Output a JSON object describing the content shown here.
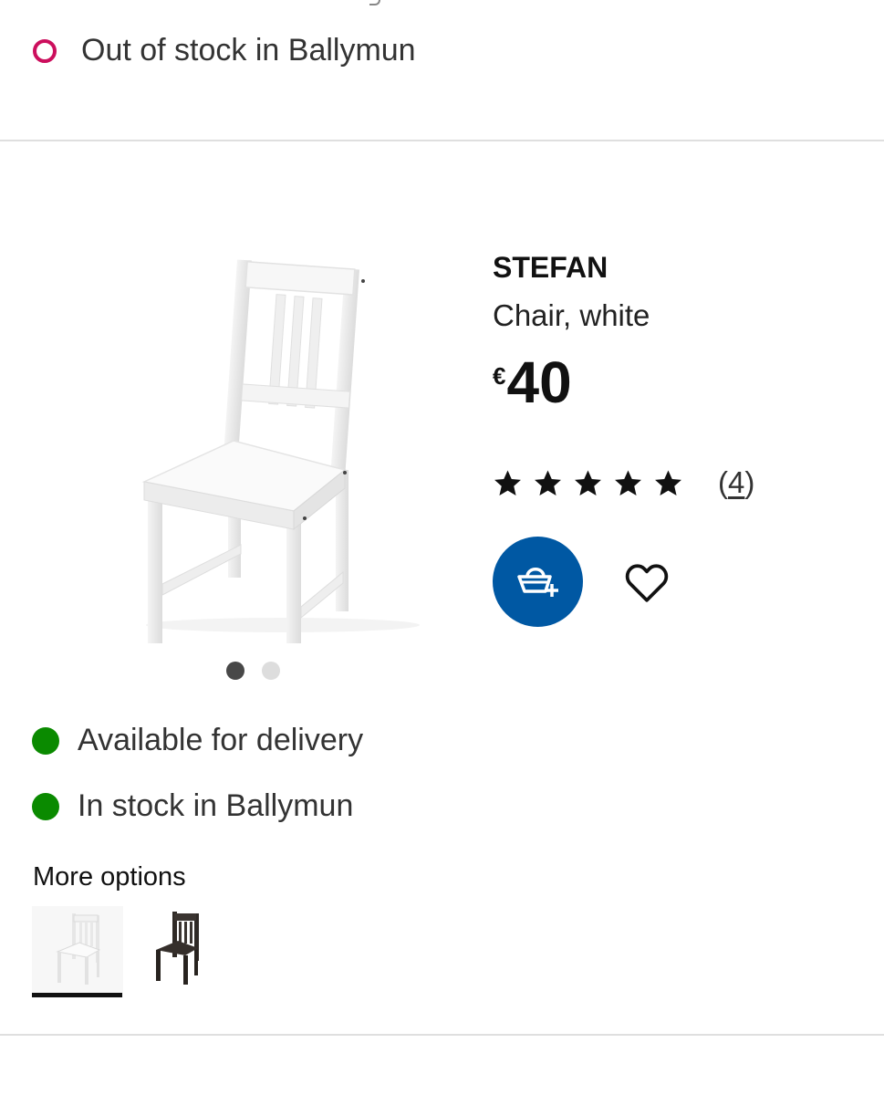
{
  "top_store": {
    "status": "out-of-stock",
    "text": "Out of stock in Ballymun",
    "status_color": "#cc0f5d"
  },
  "product": {
    "name": "STEFAN",
    "description": "Chair, white",
    "price": {
      "currency": "€",
      "amount": "40"
    },
    "rating": {
      "stars": 5,
      "max": 5,
      "count_open": "(",
      "count": "4",
      "count_close": ")"
    },
    "image_index": 1,
    "image_total": 2
  },
  "actions": {
    "add_to_cart_icon": "basket-plus-icon",
    "favourite_icon": "heart-outline-icon",
    "accent": "#0058a3"
  },
  "availability": [
    {
      "text": "Available for delivery",
      "color": "#0a8a00"
    },
    {
      "text": "In stock in Ballymun",
      "color": "#0a8a00"
    }
  ],
  "more_options": {
    "label": "More options",
    "options": [
      {
        "variant": "white",
        "selected": true
      },
      {
        "variant": "black-brown",
        "selected": false
      }
    ]
  }
}
